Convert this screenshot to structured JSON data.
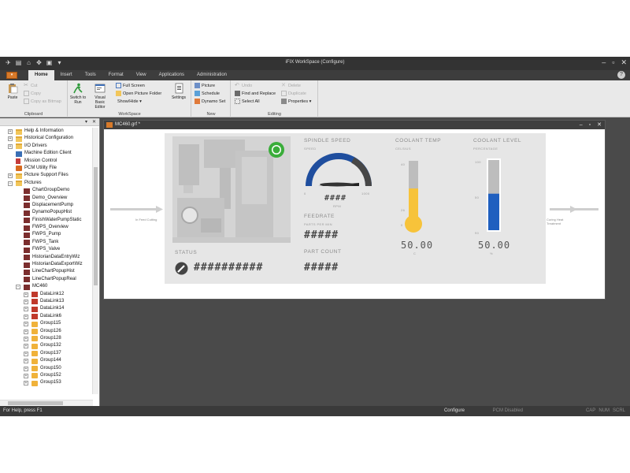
{
  "window_title": "iFIX WorkSpace (Configure)",
  "tabs": [
    "Home",
    "Insert",
    "Tools",
    "Format",
    "View",
    "Applications",
    "Administration"
  ],
  "app_button": "▾",
  "help": "?",
  "ribbon": {
    "clipboard": {
      "name": "Clipboard",
      "paste": "Paste",
      "cut": "Cut",
      "copy": "Copy",
      "copy_as_bitmap": "Copy as Bitmap"
    },
    "workspace": {
      "name": "WorkSpace",
      "switch_to_run": "Switch to Run",
      "vba_editor": "Visual Basic Editor",
      "full_screen": "Full Screen",
      "open_picture_folder": "Open Picture Folder",
      "show_hide": "Show/Hide",
      "settings": "Settings"
    },
    "new": {
      "name": "New",
      "picture": "Picture",
      "schedule": "Schedule",
      "dynamo_set": "Dynamo Set"
    },
    "editing": {
      "name": "Editing",
      "undo": "Undo",
      "find_replace": "Find and Replace",
      "select_all": "Select All",
      "delete": "Delete",
      "duplicate": "Duplicate",
      "properties": "Properties"
    }
  },
  "tree": [
    {
      "label": "Help & Information",
      "icon": "folder",
      "level": 1,
      "exp": "+"
    },
    {
      "label": "Historical Configuration",
      "icon": "folder",
      "level": 1,
      "exp": "+"
    },
    {
      "label": "I/O Drivers",
      "icon": "folder",
      "level": 1,
      "exp": "+"
    },
    {
      "label": "Machine Edition Client",
      "icon": "machine",
      "level": 1,
      "exp": ""
    },
    {
      "label": "Mission Control",
      "icon": "mission",
      "level": 1,
      "exp": ""
    },
    {
      "label": "PCM Utility File",
      "icon": "pcm",
      "level": 1,
      "exp": ""
    },
    {
      "label": "Picture Support Files",
      "icon": "folder",
      "level": 1,
      "exp": "+"
    },
    {
      "label": "Pictures",
      "icon": "folder",
      "level": 1,
      "exp": "−"
    },
    {
      "label": "ChartGroupDemo",
      "icon": "pic",
      "level": 2,
      "exp": ""
    },
    {
      "label": "Demo_Overview",
      "icon": "pic",
      "level": 2,
      "exp": ""
    },
    {
      "label": "DisplacementPump",
      "icon": "pic",
      "level": 2,
      "exp": ""
    },
    {
      "label": "DynamoPopupHist",
      "icon": "pic",
      "level": 2,
      "exp": ""
    },
    {
      "label": "FinishWaterPumpStatic",
      "icon": "pic",
      "level": 2,
      "exp": ""
    },
    {
      "label": "FWPS_Overview",
      "icon": "pic",
      "level": 2,
      "exp": ""
    },
    {
      "label": "FWPS_Pump",
      "icon": "pic",
      "level": 2,
      "exp": ""
    },
    {
      "label": "FWPS_Tank",
      "icon": "pic",
      "level": 2,
      "exp": ""
    },
    {
      "label": "FWPS_Valve",
      "icon": "pic",
      "level": 2,
      "exp": ""
    },
    {
      "label": "HistorianDataEntryWiz",
      "icon": "pic",
      "level": 2,
      "exp": ""
    },
    {
      "label": "HistorianDataExportWiz",
      "icon": "pic",
      "level": 2,
      "exp": ""
    },
    {
      "label": "LineChartPopupHist",
      "icon": "pic",
      "level": 2,
      "exp": ""
    },
    {
      "label": "LineChartPopupReal",
      "icon": "pic",
      "level": 2,
      "exp": ""
    },
    {
      "label": "MC460",
      "icon": "pic",
      "level": 2,
      "exp": "−"
    },
    {
      "label": "DataLink12",
      "icon": "dl",
      "level": 3,
      "exp": "+"
    },
    {
      "label": "DataLink13",
      "icon": "dl",
      "level": 3,
      "exp": "+"
    },
    {
      "label": "DataLink14",
      "icon": "dl",
      "level": 3,
      "exp": "+"
    },
    {
      "label": "DataLink6",
      "icon": "dl",
      "level": 3,
      "exp": "+"
    },
    {
      "label": "Group115",
      "icon": "grp",
      "level": 3,
      "exp": "+"
    },
    {
      "label": "Group126",
      "icon": "grp",
      "level": 3,
      "exp": "+"
    },
    {
      "label": "Group128",
      "icon": "grp",
      "level": 3,
      "exp": "+"
    },
    {
      "label": "Group132",
      "icon": "grp",
      "level": 3,
      "exp": "+"
    },
    {
      "label": "Group137",
      "icon": "grp",
      "level": 3,
      "exp": "+"
    },
    {
      "label": "Group144",
      "icon": "grp",
      "level": 3,
      "exp": "+"
    },
    {
      "label": "Group150",
      "icon": "grp",
      "level": 3,
      "exp": "+"
    },
    {
      "label": "Group152",
      "icon": "grp",
      "level": 3,
      "exp": "+"
    },
    {
      "label": "Group153",
      "icon": "grp",
      "level": 3,
      "exp": "+"
    }
  ],
  "document": {
    "tab_title": "MC460.grf *",
    "left_side_label": "In Feed Cutting",
    "right_side_label": "Curing Heat Treatment",
    "status_label": "STATUS",
    "status_value": "##########",
    "spindle": {
      "title": "SPINDLE SPEED",
      "sub": "SPEED",
      "min": "0",
      "max": "1000",
      "value": "####",
      "unit": "RPM"
    },
    "feedrate": {
      "title": "FEEDRATE",
      "sub": "PARTS PER MIN",
      "value": "#####"
    },
    "part_count": {
      "title": "PART COUNT",
      "value": "#####"
    },
    "coolant_temp": {
      "title": "COOLANT TEMP",
      "sub": "CELSIUS",
      "tick_top": "40",
      "tick_mid": "26",
      "tick_bot": "0",
      "value": "50.00",
      "unit": "C",
      "level": 0.55
    },
    "coolant_level": {
      "title": "COOLANT LEVEL",
      "sub": "PERCENTAGE",
      "tick_top": "100",
      "tick_mid": "50",
      "tick_bot": "90",
      "value": "50.00",
      "unit": "%",
      "level": 0.52
    }
  },
  "status_bar": {
    "help": "For Help, press F1",
    "mode": "Configure",
    "pcm": "PCM Disabled",
    "caps": "CAP",
    "num": "NUM",
    "scrl": "SCRL"
  },
  "colors": {
    "accent_orange": "#d77a2a",
    "gauge_blue": "#1f4e9e",
    "level_blue": "#1f5fbf",
    "temp_yellow": "#f7c33a",
    "status_green": "#3aad3a"
  }
}
